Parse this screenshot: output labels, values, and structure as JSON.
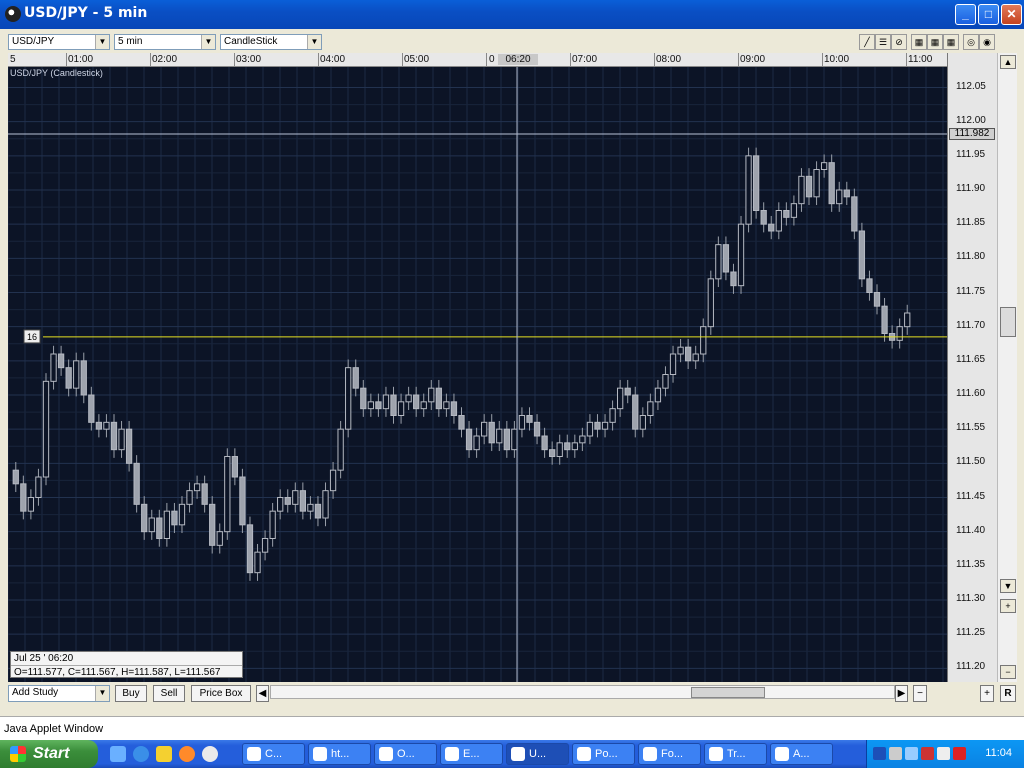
{
  "window": {
    "title": "USD/JPY - 5 min"
  },
  "toolbar": {
    "symbol": "USD/JPY",
    "interval": "5 min",
    "chart_type": "CandleStick"
  },
  "time_axis": {
    "labels": [
      "5",
      "01:00",
      "02:00",
      "03:00",
      "04:00",
      "05:00",
      "0",
      "06:20",
      "07:00",
      "08:00",
      "09:00",
      "10:00",
      "11:00"
    ]
  },
  "chart_data": {
    "type": "candlestick",
    "title": "USD/JPY (Candlestick)",
    "ylim": [
      111.18,
      112.08
    ],
    "yticks": [
      112.05,
      112.0,
      111.95,
      111.9,
      111.85,
      111.8,
      111.75,
      111.7,
      111.65,
      111.6,
      111.55,
      111.5,
      111.45,
      111.4,
      111.35,
      111.3,
      111.25,
      111.2
    ],
    "ytick_labels": [
      "112.05",
      "112.00",
      "111.95",
      "111.90",
      "111.85",
      "111.80",
      "111.75",
      "111.70",
      "111.65",
      "111.60",
      "111.55",
      "111.50",
      "111.45",
      "111.40",
      "111.35",
      "111.30",
      "111.25",
      "111.20"
    ],
    "current_price": "111.982",
    "hline_value": 111.685,
    "hline_label": "16",
    "crosshair_time": "06:20",
    "grid": true,
    "closes": [
      111.47,
      111.43,
      111.45,
      111.48,
      111.62,
      111.66,
      111.64,
      111.61,
      111.65,
      111.6,
      111.56,
      111.55,
      111.56,
      111.52,
      111.55,
      111.5,
      111.44,
      111.4,
      111.42,
      111.39,
      111.43,
      111.41,
      111.44,
      111.46,
      111.47,
      111.44,
      111.38,
      111.4,
      111.51,
      111.48,
      111.41,
      111.34,
      111.37,
      111.39,
      111.43,
      111.45,
      111.44,
      111.46,
      111.43,
      111.44,
      111.42,
      111.46,
      111.49,
      111.55,
      111.64,
      111.61,
      111.58,
      111.59,
      111.58,
      111.6,
      111.57,
      111.59,
      111.6,
      111.58,
      111.59,
      111.61,
      111.58,
      111.59,
      111.57,
      111.55,
      111.52,
      111.54,
      111.56,
      111.53,
      111.55,
      111.52,
      111.55,
      111.57,
      111.56,
      111.54,
      111.52,
      111.51,
      111.53,
      111.52,
      111.53,
      111.54,
      111.56,
      111.55,
      111.56,
      111.58,
      111.61,
      111.6,
      111.55,
      111.57,
      111.59,
      111.61,
      111.63,
      111.66,
      111.67,
      111.65,
      111.66,
      111.7,
      111.77,
      111.82,
      111.78,
      111.76,
      111.85,
      111.95,
      111.87,
      111.85,
      111.84,
      111.87,
      111.86,
      111.88,
      111.92,
      111.89,
      111.93,
      111.94,
      111.88,
      111.9,
      111.89,
      111.84,
      111.77,
      111.75,
      111.73,
      111.69,
      111.68,
      111.7,
      111.72
    ]
  },
  "info_box": {
    "date": "Jul 25 ' 06:20",
    "ohlc": "O=111.577, C=111.567, H=111.587, L=111.567"
  },
  "bottom_bar": {
    "add_study": "Add Study",
    "buy": "Buy",
    "sell": "Sell",
    "price_box": "Price Box",
    "r_button": "R"
  },
  "applet_status": "Java Applet Window",
  "taskbar": {
    "start_label": "Start",
    "tasks": [
      "C...",
      "ht...",
      "O...",
      "E...",
      "U...",
      "Po...",
      "Fo...",
      "Tr...",
      "A..."
    ],
    "clock": "11:04"
  }
}
